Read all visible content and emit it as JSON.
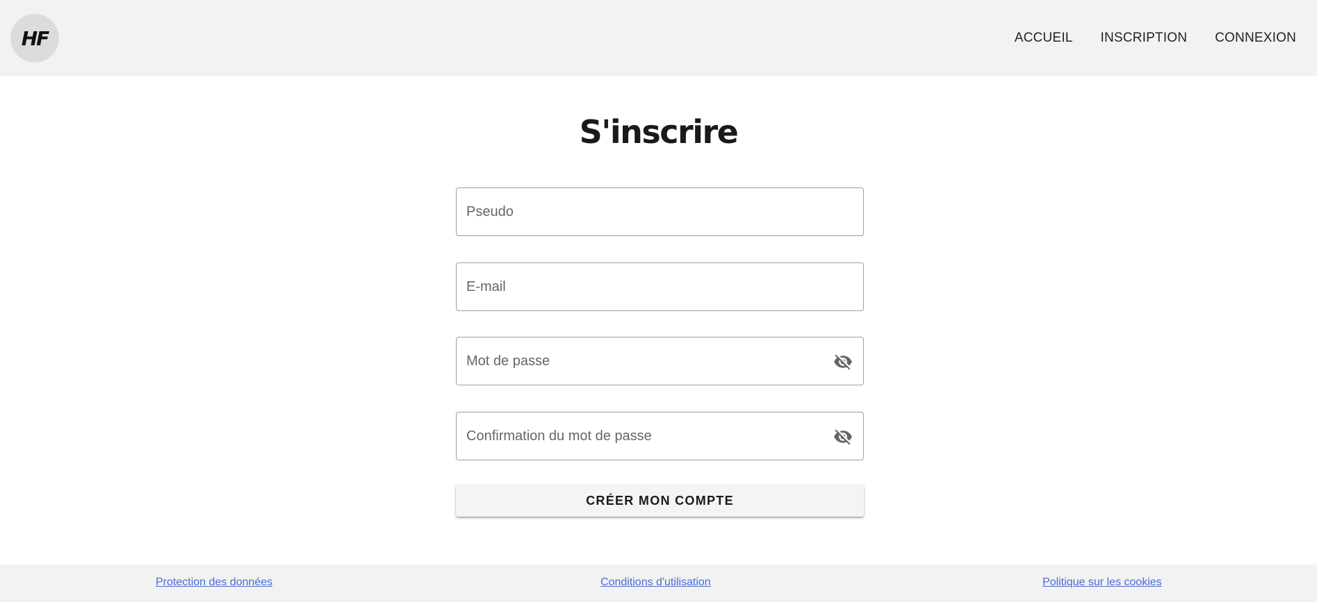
{
  "header": {
    "logo_text": "HF",
    "nav": [
      {
        "label": "ACCUEIL"
      },
      {
        "label": "INSCRIPTION"
      },
      {
        "label": "CONNEXION"
      }
    ]
  },
  "form": {
    "title": "S'inscrire",
    "fields": {
      "pseudo": {
        "placeholder": "Pseudo",
        "value": ""
      },
      "email": {
        "placeholder": "E-mail",
        "value": ""
      },
      "password": {
        "placeholder": "Mot de passe",
        "value": "",
        "icon": "eye-off-icon"
      },
      "password_confirm": {
        "placeholder": "Confirmation du mot de passe",
        "value": "",
        "icon": "eye-off-icon"
      }
    },
    "submit_label": "CRÉER MON COMPTE"
  },
  "footer": {
    "links": [
      {
        "label": "Protection des données"
      },
      {
        "label": "Conditions d'utilisation"
      },
      {
        "label": "Politique sur les cookies"
      }
    ]
  },
  "colors": {
    "header_bg": "#f2f2f2",
    "footer_bg": "#f2f2f2",
    "link": "#4a6bd0",
    "logo_bg": "#dcdcdc"
  }
}
